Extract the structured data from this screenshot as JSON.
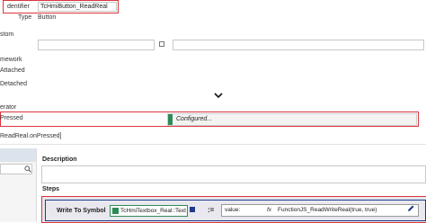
{
  "properties": {
    "identifier": {
      "label": "dentifier",
      "value": "TcHmiButton_ReadReal"
    },
    "type": {
      "label": "Type",
      "value": "Button"
    },
    "custom": {
      "label": "stom"
    },
    "framework": {
      "label": "mework"
    },
    "attached": {
      "label": "Attached"
    },
    "detached": {
      "label": "Detached"
    },
    "operator": {
      "label": "erator"
    },
    "pressed": {
      "label": "Pressed",
      "value": "Configured..."
    },
    "event_path": "ReadReal.onPressed]"
  },
  "editor": {
    "description_label": "Description",
    "steps_label": "Steps",
    "step": {
      "action": "Write To Symbol",
      "symbol": "TcHmiTextbox_Real::Text",
      "symbol_icon": "symbol-icon",
      "assign": ":=",
      "value_label": "value:",
      "fx": "fx",
      "function_value": "FunctionJS_ReadWriteReal(true, true)"
    }
  },
  "colors": {
    "highlight": "#d9363e",
    "accent_green": "#2e8b57",
    "border": "#c8c8c8"
  }
}
